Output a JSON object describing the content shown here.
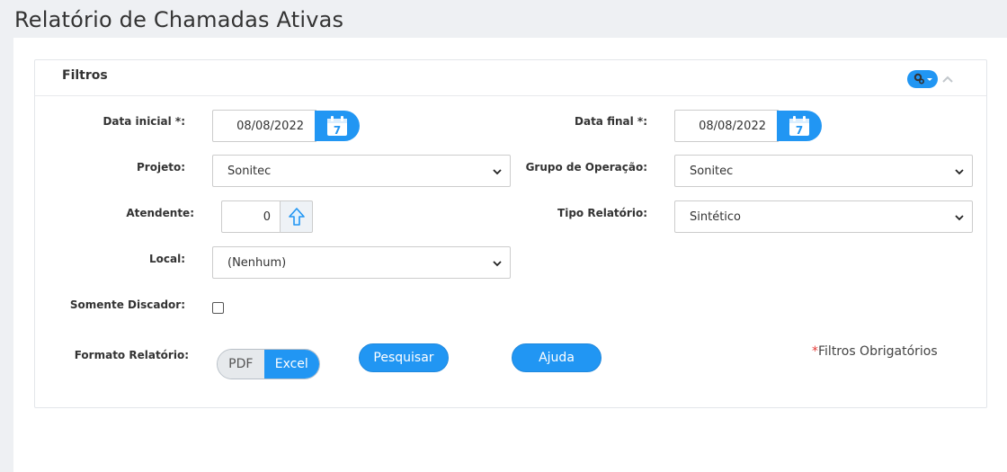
{
  "page": {
    "title": "Relatório de Chamadas Ativas"
  },
  "panel": {
    "title": "Filtros"
  },
  "filters": {
    "data_inicial": {
      "label": "Data inicial *:",
      "value": "08/08/2022",
      "calendar_day": "7"
    },
    "data_final": {
      "label": "Data final *:",
      "value": "08/08/2022",
      "calendar_day": "7"
    },
    "projeto": {
      "label": "Projeto:",
      "value": "Sonitec"
    },
    "grupo_operacao": {
      "label": "Grupo de Operação:",
      "value": "Sonitec"
    },
    "atendente": {
      "label": "Atendente:",
      "value": "0"
    },
    "tipo_relatorio": {
      "label": "Tipo Relatório:",
      "value": "Sintético"
    },
    "local": {
      "label": "Local:",
      "value": "(Nenhum)"
    },
    "somente_discador": {
      "label": "Somente Discador:",
      "checked": false
    },
    "formato_relatorio": {
      "label": "Formato Relatório:",
      "options": [
        "PDF",
        "Excel"
      ],
      "selected": "Excel"
    }
  },
  "actions": {
    "pesquisar": "Pesquisar",
    "ajuda": "Ajuda"
  },
  "required_note": {
    "star": "*",
    "text": "Filtros Obrigatórios"
  },
  "colors": {
    "accent": "#2196f3",
    "background": "#eef0f3"
  }
}
